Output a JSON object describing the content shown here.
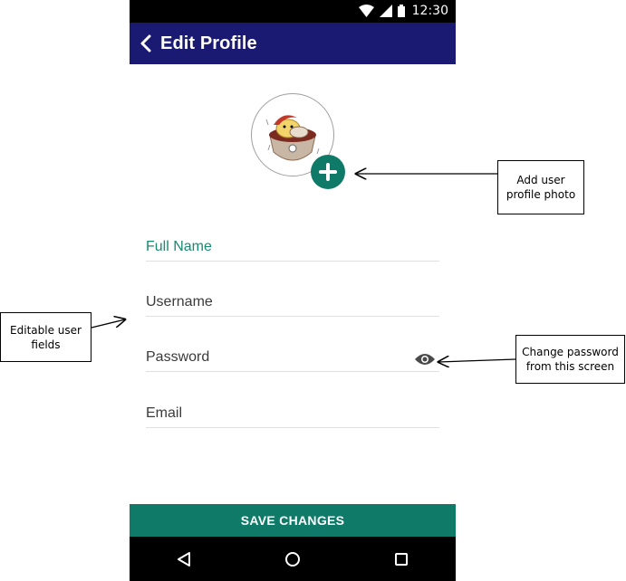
{
  "status_bar": {
    "time": "12:30",
    "icons": [
      "wifi-icon",
      "signal-icon",
      "battery-icon"
    ]
  },
  "app_bar": {
    "title": "Edit Profile",
    "back_icon": "chevron-left-icon",
    "color": "#1a1a72"
  },
  "profile_photo": {
    "add_icon": "plus-icon",
    "accent": "#0f7a68"
  },
  "form": {
    "full_name": {
      "placeholder": "Full Name",
      "value": ""
    },
    "username": {
      "placeholder": "Username",
      "value": ""
    },
    "password": {
      "placeholder": "Password",
      "value": "",
      "toggle_icon": "eye-icon"
    },
    "email": {
      "placeholder": "Email",
      "value": ""
    }
  },
  "save_button": {
    "label": "SAVE CHANGES",
    "color": "#0f7a68"
  },
  "nav_bar": {
    "icons": [
      "back-triangle-icon",
      "home-circle-icon",
      "recents-square-icon"
    ]
  },
  "annotations": {
    "photo": [
      "Add user",
      "profile photo"
    ],
    "fields": [
      "Editable user",
      "fields"
    ],
    "password": [
      "Change password",
      "from this screen"
    ]
  }
}
